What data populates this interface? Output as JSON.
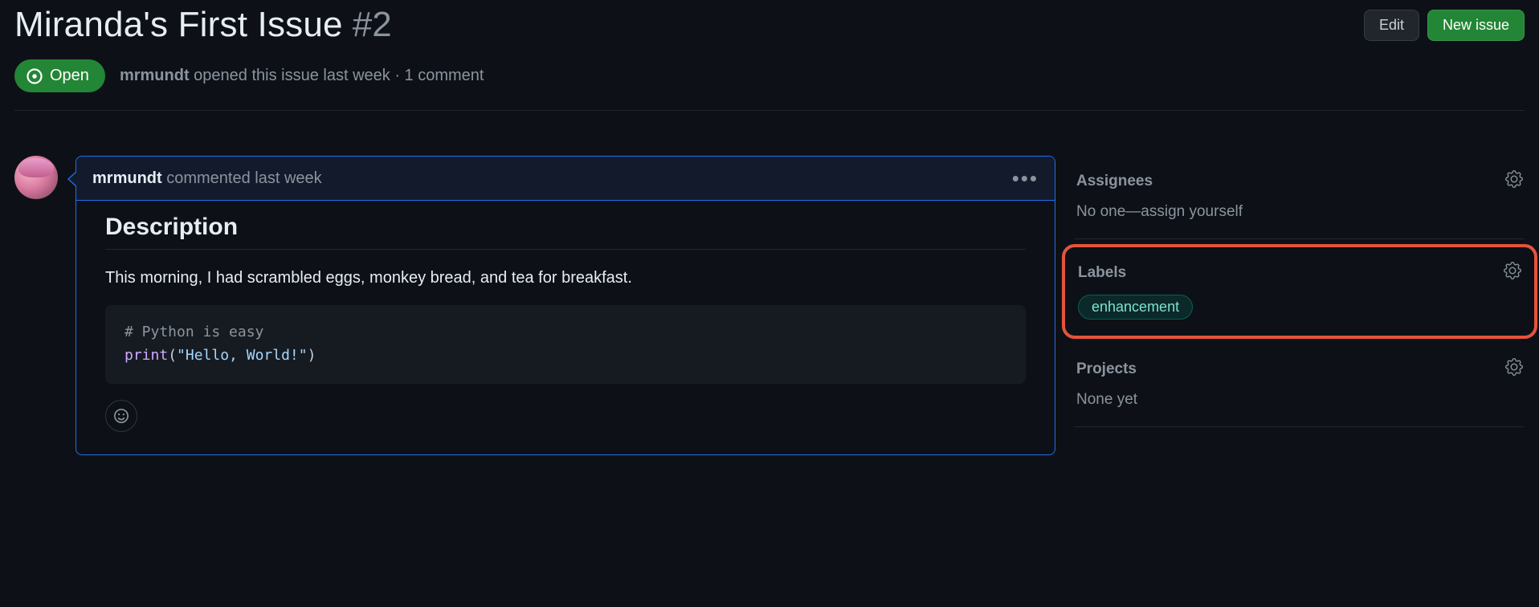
{
  "header": {
    "title": "Miranda's First Issue",
    "number": "#2",
    "edit_label": "Edit",
    "new_issue_label": "New issue"
  },
  "meta": {
    "state": "Open",
    "author": "mrmundt",
    "opened_text": "opened this issue last week · 1 comment"
  },
  "comment": {
    "author": "mrmundt",
    "action_text": "commented last week",
    "heading": "Description",
    "paragraph": "This morning, I had scrambled eggs, monkey bread, and tea for breakfast.",
    "code": {
      "comment_line": "# Python is easy",
      "func": "print",
      "open": "(",
      "string": "\"Hello, World!\"",
      "close": ")"
    }
  },
  "sidebar": {
    "assignees": {
      "title": "Assignees",
      "none_text": "No one—",
      "assign_self": "assign yourself"
    },
    "labels": {
      "title": "Labels",
      "items": [
        "enhancement"
      ]
    },
    "projects": {
      "title": "Projects",
      "none_text": "None yet"
    }
  }
}
